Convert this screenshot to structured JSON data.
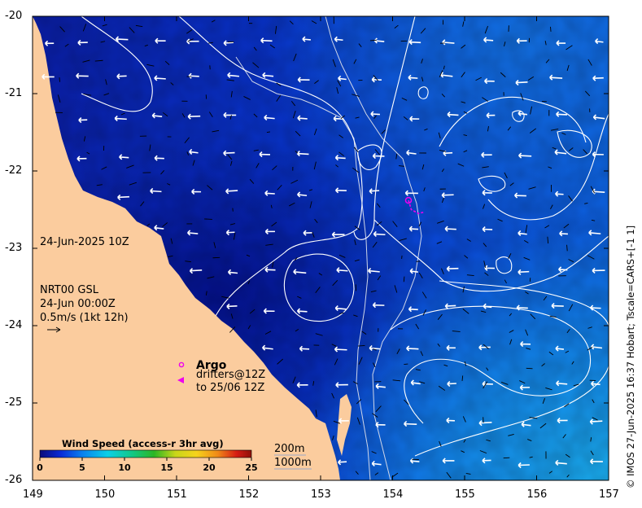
{
  "map": {
    "x_axis_ticks": [
      "149",
      "150",
      "151",
      "152",
      "153",
      "154",
      "155",
      "156",
      "157"
    ],
    "y_axis_ticks": [
      "-20",
      "-21",
      "-22",
      "-23",
      "-24",
      "-25",
      "-26"
    ],
    "x_range": [
      149,
      157
    ],
    "y_range": [
      -26,
      -20
    ],
    "date_label": "24-Jun-2025 10Z",
    "source_label": "NRT00 GSL",
    "source_time": "24-Jun 00:00Z",
    "vector_scale_label": "0.5m/s (1kt 12h)",
    "argo_label": "Argo",
    "drifters_label": "drifters@12Z",
    "drifters_to_label": "to 25/06 12Z",
    "isobath_200": "200m",
    "isobath_1000": "1000m",
    "credit": "© IMOS 27-Jun-2025 16:37 Hobart; Tscale=CARS+[-1 1]",
    "colors": {
      "land": "#fbcc9e",
      "argo_marker": "#ee00ee",
      "contour": "#ffffff",
      "bathymetry": "#cfd6e8"
    },
    "colorbar": {
      "title": "Wind Speed (access-r 3hr avg)",
      "ticks": [
        "0",
        "5",
        "10",
        "15",
        "20",
        "25"
      ],
      "range": [
        0,
        25
      ]
    },
    "drifter_track": [
      [
        154.22,
        -22.38
      ],
      [
        154.26,
        -22.5
      ],
      [
        154.36,
        -22.55
      ],
      [
        154.44,
        -22.53
      ]
    ]
  }
}
